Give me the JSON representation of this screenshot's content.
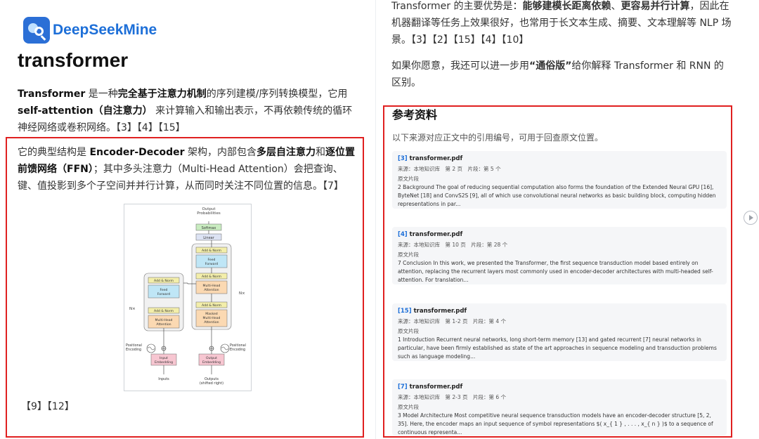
{
  "brand": {
    "name": "DeepSeekMine",
    "logo_icon": "brain-search-icon"
  },
  "main": {
    "title": "transformer",
    "para1": {
      "s1": "Transformer",
      "s2": " 是一种",
      "s3": "完全基于注意力机制",
      "s4": "的序列建模/序列转换模型，它用 ",
      "s5": "self-attention（自注意力）",
      "s6": " 来计算输入和输出表示，不再依赖传统的循环神经网络或卷积网络。【3】【4】【15】"
    },
    "para2": {
      "s1": "它的典型结构是 ",
      "s2": "Encoder-Decoder",
      "s3": " 架构，内部包含",
      "s4": "多层自注意力",
      "s5": "和",
      "s6": "逐位置前馈网络（FFN）",
      "s7": "；其中多头注意力（Multi-Head Attention）会把查询、键、值投影到多个子空间并并行计算，从而同时关注不同位置的信息。【7】"
    },
    "refs_line": "【9】【12】"
  },
  "figure": {
    "output_probs": "Output\nProbabilities",
    "softmax": "Softmax",
    "linear": "Linear",
    "add_norm": "Add & Norm",
    "feed_forward": "Feed\nForward",
    "multi_head": "Multi-Head\nAttention",
    "masked_multi_head": "Masked\nMulti-Head\nAttention",
    "nx": "N×",
    "positional_encoding": "Positional\nEncoding",
    "input_embedding": "Input\nEmbedding",
    "output_embedding": "Output\nEmbedding",
    "inputs": "Inputs",
    "outputs": "Outputs\n(shifted right)"
  },
  "right": {
    "para1": {
      "s1": "Transformer 的主要优势是：",
      "s2": "能够建模长距离依赖",
      "s3": "、",
      "s4": "更容易并行计算",
      "s5": "，因此在机器翻译等任务上效果很好，也常用于长文本生成、摘要、文本理解等 NLP 场景。【3】【2】【15】【4】【10】"
    },
    "para2": {
      "s1": "如果你愿意，我还可以进一步用",
      "s2": "“通俗版”",
      "s3": "给你解释 Transformer 和 RNN 的区别。"
    },
    "references": {
      "title": "参考资料",
      "subtitle": "以下来源对应正文中的引用编号，可用于回查原文位置。",
      "snippet_label": "原文片段",
      "items": [
        {
          "num": "[3]",
          "file": "transformer.pdf",
          "meta": "来源：本地知识库　第 2 页　片段：第 5 个",
          "text": "2 Background The goal of reducing sequential computation also forms the foundation of the Extended Neural GPU [16], ByteNet [18] and ConvS2S [9], all of which use convolutional neural networks as basic building block, computing hidden representations in par..."
        },
        {
          "num": "[4]",
          "file": "transformer.pdf",
          "meta": "来源：本地知识库　第 10 页　片段：第 28 个",
          "text": "7 Conclusion In this work, we presented the Transformer, the first sequence transduction model based entirely on attention, replacing the recurrent layers most commonly used in encoder-decoder architectures with multi-headed self-attention. For translation..."
        },
        {
          "num": "[15]",
          "file": "transformer.pdf",
          "meta": "来源：本地知识库　第 1-2 页　片段：第 4 个",
          "text": "1 Introduction Recurrent neural networks, long short-term memory [13] and gated recurrent [7] neural networks in particular, have been firmly established as state of the art approaches in sequence modeling and transduction problems such as language modeling..."
        },
        {
          "num": "[7]",
          "file": "transformer.pdf",
          "meta": "来源：本地知识库　第 2-3 页　片段：第 6 个",
          "text": "3 Model Architecture Most competitive neural sequence transduction models have an encoder-decoder structure [5, 2, 35]. Here, the encoder maps an input sequence of symbol representations $( x_{ 1 } , . . . , x_{ n } )$ to a sequence of continuous representa..."
        }
      ]
    }
  },
  "nav": {
    "next_icon": "play-circle-icon"
  },
  "colors": {
    "brand": "#1d6fd8",
    "highlight_box": "#e02020",
    "card_bg": "#f5f6f8"
  }
}
